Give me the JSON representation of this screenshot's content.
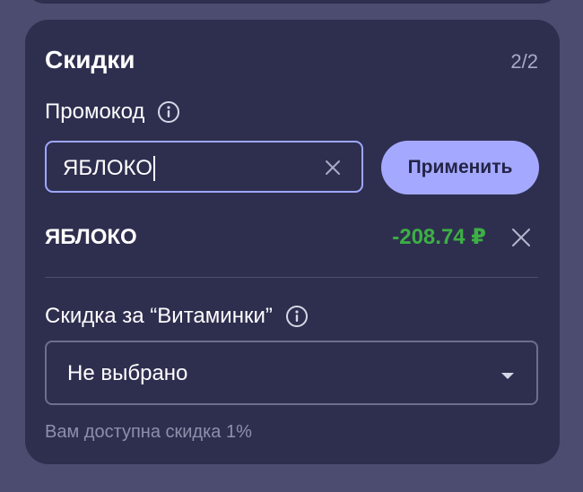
{
  "discounts": {
    "title": "Скидки",
    "counter": "2/2",
    "promo": {
      "label": "Промокод",
      "info_icon": "info-icon",
      "input_value": "ЯБЛОКО",
      "clear_icon": "close-icon",
      "apply_label": "Применить"
    },
    "applied": {
      "code": "ЯБЛОКО",
      "amount": "-208.74 ₽",
      "remove_icon": "close-icon"
    },
    "vitaminki": {
      "label": "Скидка за “Витаминки”",
      "info_icon": "info-icon",
      "selected": "Не выбрано",
      "dropdown_icon": "chevron-down-icon",
      "hint": "Вам доступна скидка 1%"
    }
  },
  "colors": {
    "background": "#4b4c6f",
    "card": "#2e2f4f",
    "accent": "#a4a9ff",
    "input_border": "#9ea7ff",
    "discount_green": "#3cb043",
    "muted_text": "#8e8fab"
  }
}
